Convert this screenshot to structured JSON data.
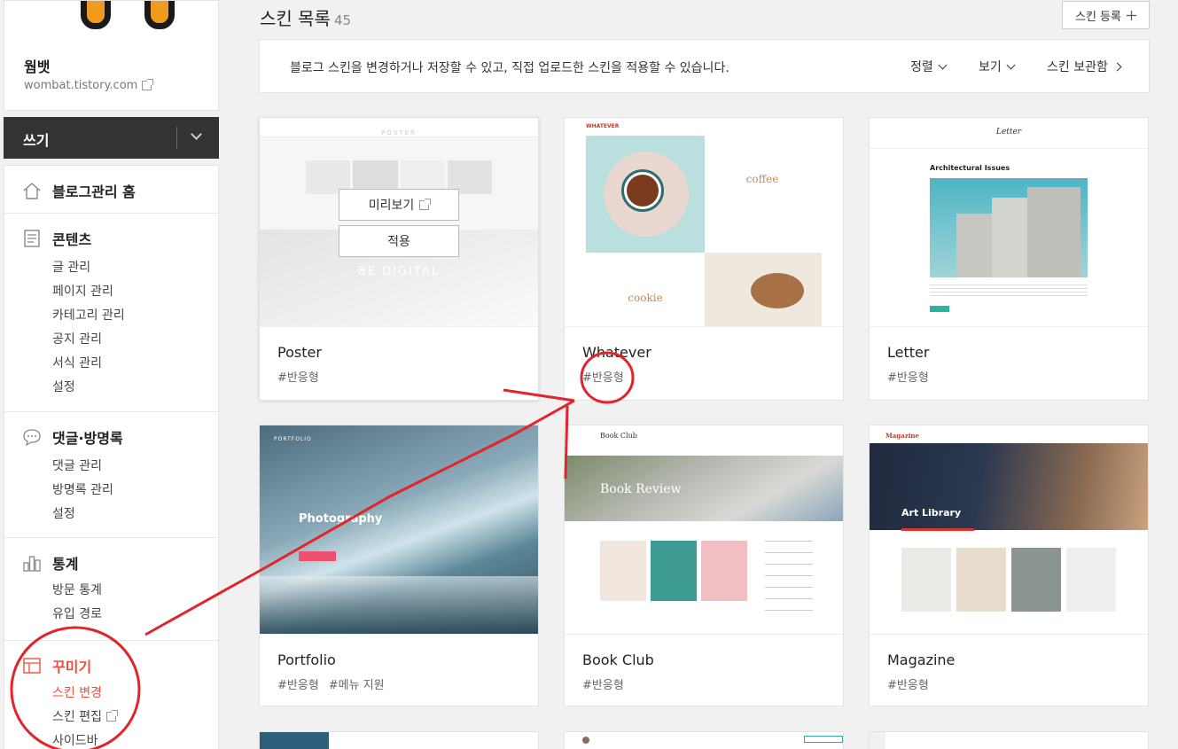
{
  "sidebar": {
    "blog_name": "웜뱃",
    "blog_url": "wombat.tistory.com",
    "write_label": "쓰기",
    "sections": [
      {
        "label": "블로그관리 홈"
      },
      {
        "label": "콘텐츠",
        "items": [
          "글 관리",
          "페이지 관리",
          "카테고리 관리",
          "공지 관리",
          "서식 관리",
          "설정"
        ]
      },
      {
        "label": "댓글·방명록",
        "items": [
          "댓글 관리",
          "방명록 관리",
          "설정"
        ]
      },
      {
        "label": "통계",
        "items": [
          "방문 통계",
          "유입 경로"
        ]
      },
      {
        "label": "꾸미기",
        "items": [
          "스킨 변경",
          "스킨 편집",
          "사이드바"
        ]
      }
    ]
  },
  "main": {
    "title": "스킨 목록",
    "count": "45",
    "register_label": "스킨 등록",
    "description": "블로그 스킨을 변경하거나 저장할 수 있고, 직접 업로드한 스킨을 적용할 수 있습니다.",
    "sort_label": "정렬",
    "view_label": "보기",
    "storage_label": "스킨 보관함",
    "overlay": {
      "preview_label": "미리보기",
      "apply_label": "적용"
    },
    "skins": [
      {
        "name": "Poster",
        "tags": [
          "#반응형"
        ],
        "thumb_text": "POSTER",
        "thumb_caption": "BE DIGITAL"
      },
      {
        "name": "Whatever",
        "tags": [
          "#반응형"
        ],
        "thumb_text": "WHATEVER",
        "thumb_word1": "coffee",
        "thumb_word2": "cookie"
      },
      {
        "name": "Letter",
        "tags": [
          "#반응형"
        ],
        "thumb_text": "Letter",
        "thumb_heading": "Architectural Issues"
      },
      {
        "name": "Portfolio",
        "tags": [
          "#반응형",
          "#메뉴 지원"
        ],
        "thumb_text": "PORTFOLIO",
        "thumb_heading": "Photography"
      },
      {
        "name": "Book Club",
        "tags": [
          "#반응형"
        ],
        "thumb_text": "Book Club",
        "thumb_heading": "Book Review"
      },
      {
        "name": "Magazine",
        "tags": [
          "#반응형"
        ],
        "thumb_text": "Magazine",
        "thumb_heading": "Art Library"
      }
    ]
  },
  "colors": {
    "accent": "#f04d3c",
    "annotation": "#e0252b"
  }
}
